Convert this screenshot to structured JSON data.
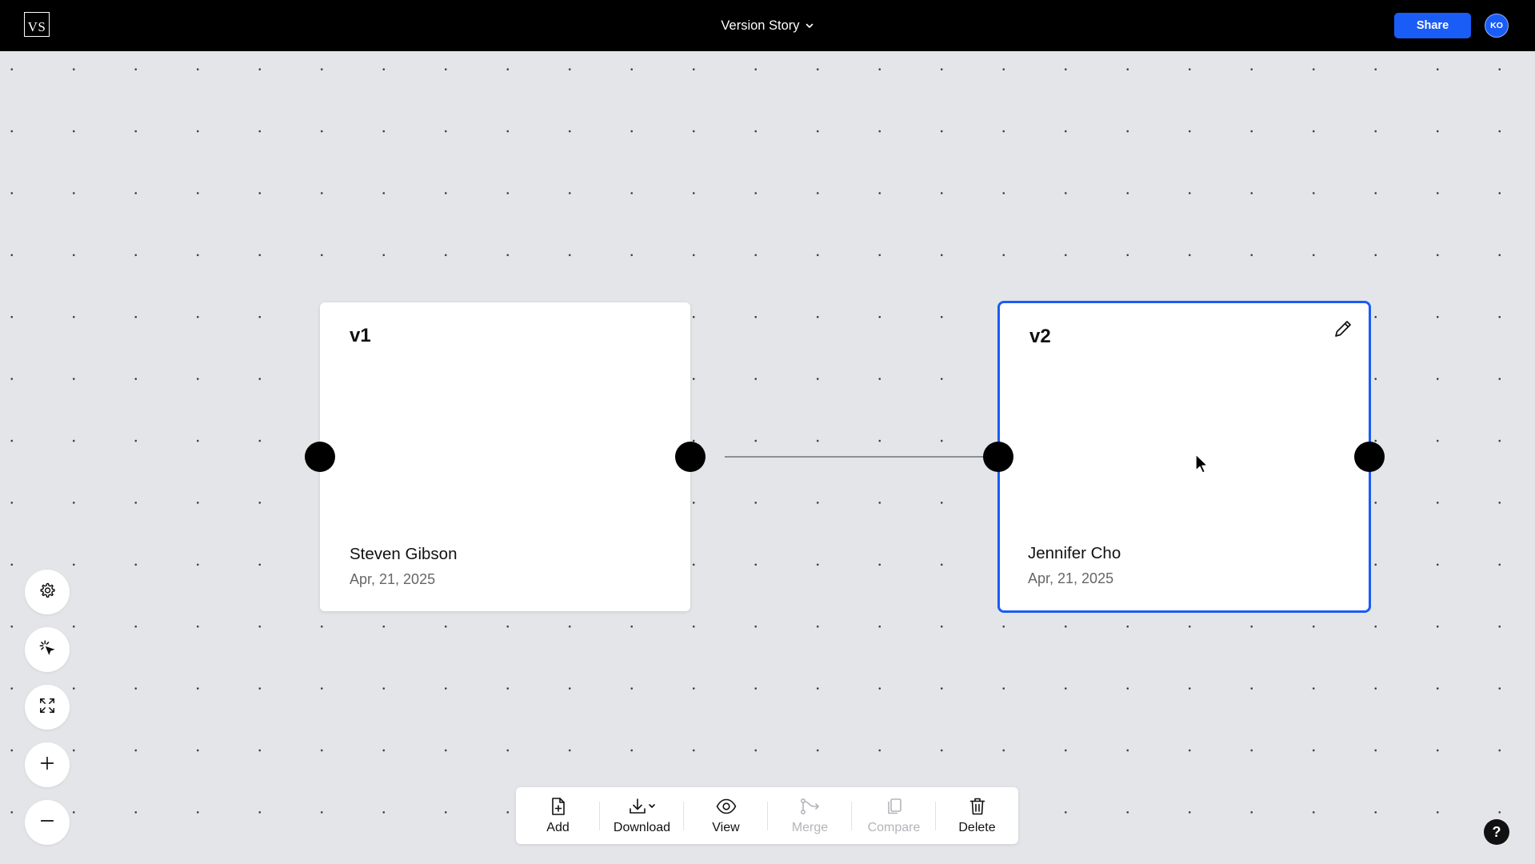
{
  "app": {
    "logo_text": "VS",
    "doc_title": "Version Story"
  },
  "header": {
    "share_label": "Share",
    "avatar_initials": "KO"
  },
  "nodes": [
    {
      "title": "v1",
      "author": "Steven Gibson",
      "date": "Apr, 21, 2025",
      "selected": false
    },
    {
      "title": "v2",
      "author": "Jennifer Cho",
      "date": "Apr, 21, 2025",
      "selected": true
    }
  ],
  "left_tools": [
    {
      "icon": "gear-icon"
    },
    {
      "icon": "magic-select-icon"
    },
    {
      "icon": "fit-view-icon"
    },
    {
      "icon": "zoom-in-icon"
    },
    {
      "icon": "zoom-out-icon"
    }
  ],
  "toolbar": {
    "items": [
      {
        "label": "Add",
        "icon": "file-add-icon",
        "enabled": true
      },
      {
        "label": "Download",
        "icon": "download-icon",
        "enabled": true
      },
      {
        "label": "View",
        "icon": "eye-icon",
        "enabled": true
      },
      {
        "label": "Merge",
        "icon": "merge-icon",
        "enabled": false
      },
      {
        "label": "Compare",
        "icon": "compare-icon",
        "enabled": false
      },
      {
        "label": "Delete",
        "icon": "trash-icon",
        "enabled": true
      }
    ]
  },
  "help": {
    "label": "?"
  },
  "colors": {
    "accent": "#1a5cf6",
    "canvas": "#e4e5e9",
    "topbar": "#000000",
    "disabled_text": "#b3b5ba"
  }
}
